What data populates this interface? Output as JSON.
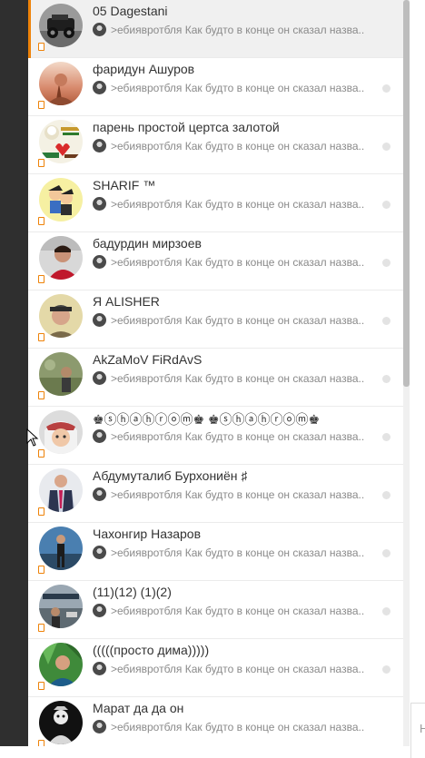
{
  "chats": [
    {
      "name": "05 Dagestani",
      "message": ">ебиявротбля Как будто в конце он сказал назва...",
      "active": true,
      "unread_dot": false,
      "avatar": "car-photo-avatar"
    },
    {
      "name": "фаридун Ашуров",
      "message": ">ебиявротбля Как будто в конце он сказал назва...",
      "active": false,
      "unread_dot": true,
      "avatar": "sunset-photo-avatar"
    },
    {
      "name": "парень простой цертса залотой",
      "message": ">ебиявротбля Как будто в конце он сказал назва...",
      "active": false,
      "unread_dot": true,
      "avatar": "greeting-card-avatar"
    },
    {
      "name": "SHARIF ™",
      "message": ">ебиявротбля Как будто в конце он сказал назва...",
      "active": false,
      "unread_dot": true,
      "avatar": "cartoon-avatar"
    },
    {
      "name": "бадурдин мирзоев",
      "message": ">ебиявротбля Как будто в конце он сказал назва...",
      "active": false,
      "unread_dot": true,
      "avatar": "man-red-shirt-avatar"
    },
    {
      "name": "Я ALISHER",
      "message": ">ебиявротбля Как будто в конце он сказал назва...",
      "active": false,
      "unread_dot": true,
      "avatar": "man-cap-avatar"
    },
    {
      "name": "AkZaMoV FiRdAvS",
      "message": ">ебиявротбля Как будто в конце он сказал назва...",
      "active": false,
      "unread_dot": true,
      "avatar": "outdoor-photo-avatar"
    },
    {
      "name": "♚ⓢⓗⓐⓗⓡⓞⓜ♚ ♚ⓢⓗⓐⓗⓡⓞⓜ♚",
      "message": ">ебиявротбля Как будто в конце он сказал назва...",
      "active": false,
      "unread_dot": true,
      "avatar": "child-avatar"
    },
    {
      "name": "Абдумуталиб Бурхониён ♯",
      "message": ">ебиявротбля Как будто в конце он сказал назва...",
      "active": false,
      "unread_dot": true,
      "avatar": "man-suit-avatar"
    },
    {
      "name": "Чахонгир Назаров",
      "message": ">ебиявротбля Как будто в конце он сказал назва...",
      "active": false,
      "unread_dot": true,
      "avatar": "man-standing-avatar"
    },
    {
      "name": "(11)(12) (1)(2)",
      "message": ">ебиявротбля Как будто в конце он сказал назва...",
      "active": false,
      "unread_dot": true,
      "avatar": "street-photo-avatar"
    },
    {
      "name": "(((((просто дима)))))",
      "message": ">ебиявротбля Как будто в конце он сказал назва...",
      "active": false,
      "unread_dot": true,
      "avatar": "green-shirt-avatar"
    },
    {
      "name": "Марат да да он",
      "message": ">ебиявротбля Как будто в конце он сказал назва...",
      "active": false,
      "unread_dot": false,
      "avatar": "bw-sketch-avatar"
    }
  ],
  "input_peek_text": "Н",
  "colors": {
    "accent": "#ee8208",
    "active_bg": "#f0f0f0",
    "sidebar_dark": "#2f2f2f"
  }
}
